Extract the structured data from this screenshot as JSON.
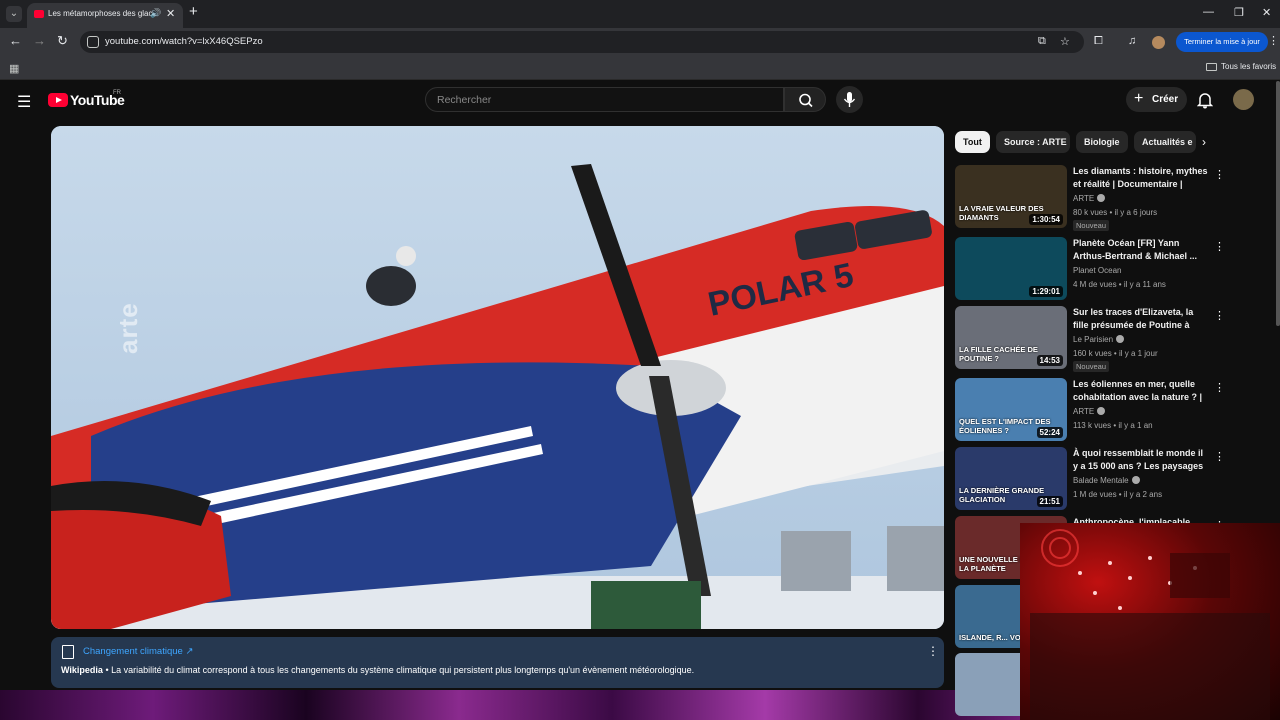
{
  "browser": {
    "tab_title": "Les métamorphoses des glaciers",
    "url": "youtube.com/watch?v=lxX46QSEPzo",
    "update_label": "Terminer la mise à jour",
    "favorites_label": "Tous les favoris"
  },
  "masthead": {
    "logo_text": "YouTube",
    "region": "FR",
    "search_placeholder": "Rechercher",
    "create_label": "Créer"
  },
  "player": {
    "watermark": "arte",
    "plane_text": "POLAR 5"
  },
  "info_panel": {
    "title": "Changement climatique ↗",
    "source": "Wikipedia",
    "text": " • La variabilité du climat correspond à tous les changements du système climatique qui persistent plus longtemps qu'un évènement météorologique."
  },
  "chips": [
    "Tout",
    "Source : ARTE",
    "Biologie",
    "Actualités e"
  ],
  "videos": [
    {
      "title": "Les diamants : histoire, mythes et réalité | Documentaire | ARTE",
      "channel": "ARTE",
      "verified": true,
      "meta": "80 k vues • il y a 6 jours",
      "badge": "Nouveau",
      "duration": "1:30:54",
      "thumb_text": "La vraie valeur des diamants",
      "thumb_color": "#3a3020"
    },
    {
      "title": "Planète Océan [FR] Yann Arthus-Bertrand & Michael ...",
      "channel": "Planet Ocean",
      "verified": false,
      "meta": "4 M de vues • il y a 11 ans",
      "badge": "",
      "duration": "1:29:01",
      "thumb_text": "",
      "thumb_color": "#0d4a5c"
    },
    {
      "title": "Sur les traces d'Elizaveta, la fille présumée de Poutine à Paris",
      "channel": "Le Parisien",
      "verified": true,
      "meta": "160 k vues • il y a 1 jour",
      "badge": "Nouveau",
      "duration": "14:53",
      "thumb_text": "La fille cachée de Poutine ?",
      "thumb_color": "#6a6e78"
    },
    {
      "title": "Les éoliennes en mer, quelle cohabitation avec la nature ? | ...",
      "channel": "ARTE",
      "verified": true,
      "meta": "113 k vues • il y a 1 an",
      "badge": "",
      "duration": "52:24",
      "thumb_text": "Quel est l'impact des éoliennes ?",
      "thumb_color": "#4a7fb0"
    },
    {
      "title": "À quoi ressemblait le monde il y a 15 000 ans ? Les paysages ...",
      "channel": "Balade Mentale",
      "verified": true,
      "meta": "1 M de vues • il y a 2 ans",
      "badge": "",
      "duration": "21:51",
      "thumb_text": "La dernière grande glaciation",
      "thumb_color": "#2a3a6a"
    },
    {
      "title": "Anthropocène, l'implacable",
      "channel": "",
      "verified": false,
      "meta": "",
      "badge": "",
      "duration": "",
      "thumb_text": "Une nouvelle ère pour la planète",
      "thumb_color": "#6a2a2a"
    },
    {
      "title": "",
      "channel": "",
      "verified": false,
      "meta": "",
      "badge": "",
      "duration": "",
      "thumb_text": "Islande, r... voyag...",
      "thumb_color": "#3a6a90"
    },
    {
      "title": "",
      "channel": "",
      "verified": false,
      "meta": "",
      "badge": "",
      "duration": "",
      "thumb_text": "",
      "thumb_color": "#8aa0b8"
    }
  ]
}
